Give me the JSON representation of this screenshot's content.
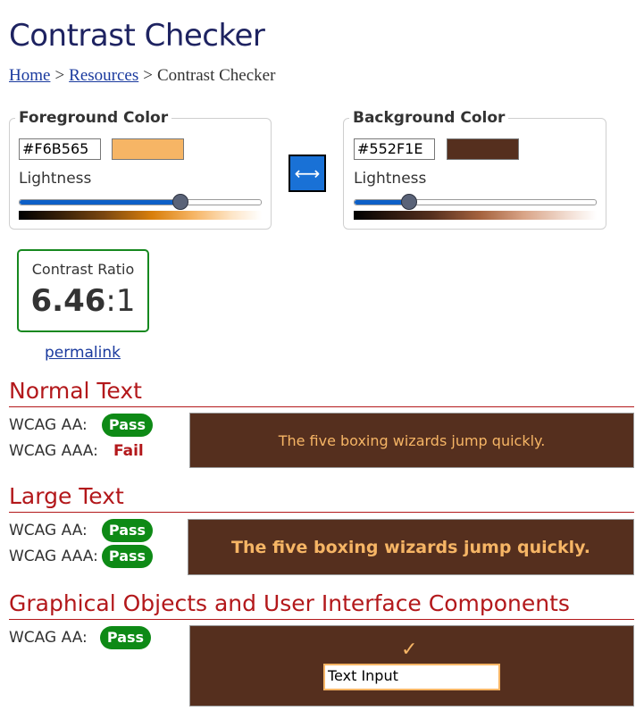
{
  "page": {
    "title": "Contrast Checker"
  },
  "breadcrumb": {
    "home": "Home",
    "resources": "Resources",
    "current": "Contrast Checker",
    "separator": ">"
  },
  "foreground": {
    "legend": "Foreground Color",
    "hex": "#F6B565",
    "color": "#F6B565",
    "lightness_label": "Lightness",
    "lightness_level": 0.67
  },
  "background": {
    "legend": "Background Color",
    "hex": "#552F1E",
    "color": "#552F1E",
    "lightness_label": "Lightness",
    "lightness_level": 0.23
  },
  "swap": {
    "icon": "swap-horizontal-icon",
    "glyph": "⟷"
  },
  "ratio": {
    "label": "Contrast Ratio",
    "value": "6.46",
    "suffix": ":1"
  },
  "permalink": "permalink",
  "normal_text": {
    "heading": "Normal Text",
    "aa_label": "WCAG AA:",
    "aa_result": "Pass",
    "aaa_label": "WCAG AAA:",
    "aaa_result": "Fail",
    "sample": "The five boxing wizards jump quickly."
  },
  "large_text": {
    "heading": "Large Text",
    "aa_label": "WCAG AA:",
    "aa_result": "Pass",
    "aaa_label": "WCAG AAA:",
    "aaa_result": "Pass",
    "sample": "The five boxing wizards jump quickly."
  },
  "graphical": {
    "heading": "Graphical Objects and User Interface Components",
    "aa_label": "WCAG AA:",
    "aa_result": "Pass",
    "check_glyph": "✓",
    "input_value": "Text Input"
  },
  "colors": {
    "heading": "#1e2361",
    "accent_red": "#b3181b",
    "pass_green": "#0e8a16",
    "link_blue": "#1a3a9e",
    "slider_blue": "#0d5fc7"
  }
}
